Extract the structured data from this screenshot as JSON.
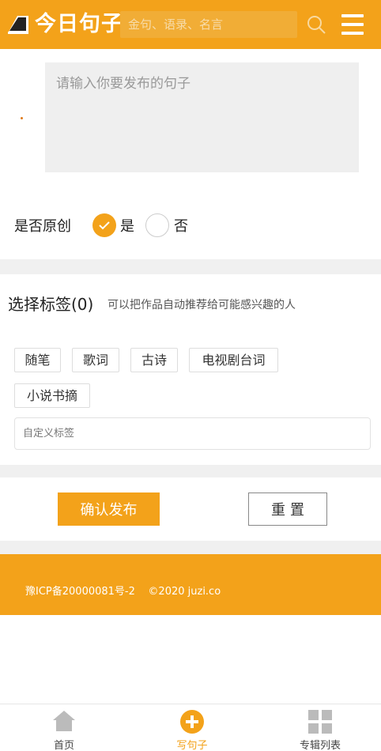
{
  "header": {
    "logo_text": "今日句子",
    "search_placeholder": "金句、语录、名言",
    "brand_color": "#f3a21a"
  },
  "compose": {
    "placeholder": "请输入你要发布的句子",
    "original_label": "是否原创",
    "option_yes": "是",
    "option_no": "否",
    "selected": "是"
  },
  "tags": {
    "title": "选择标签(0)",
    "hint": "可以把作品自动推荐给可能感兴趣的人",
    "items": [
      "随笔",
      "歌词",
      "古诗",
      "电视剧台词",
      "小说书摘"
    ],
    "custom_placeholder": "自定义标签"
  },
  "actions": {
    "confirm_label": "确认发布",
    "reset_label": "重置"
  },
  "footer": {
    "icp": "豫ICP备20000081号-2",
    "copyright": "©2020 juzi.co"
  },
  "tabbar": {
    "items": [
      {
        "label": "首页",
        "icon": "home-icon"
      },
      {
        "label": "写句子",
        "icon": "plus-circle-icon"
      },
      {
        "label": "专辑列表",
        "icon": "grid-icon"
      }
    ],
    "active": "写句子"
  }
}
